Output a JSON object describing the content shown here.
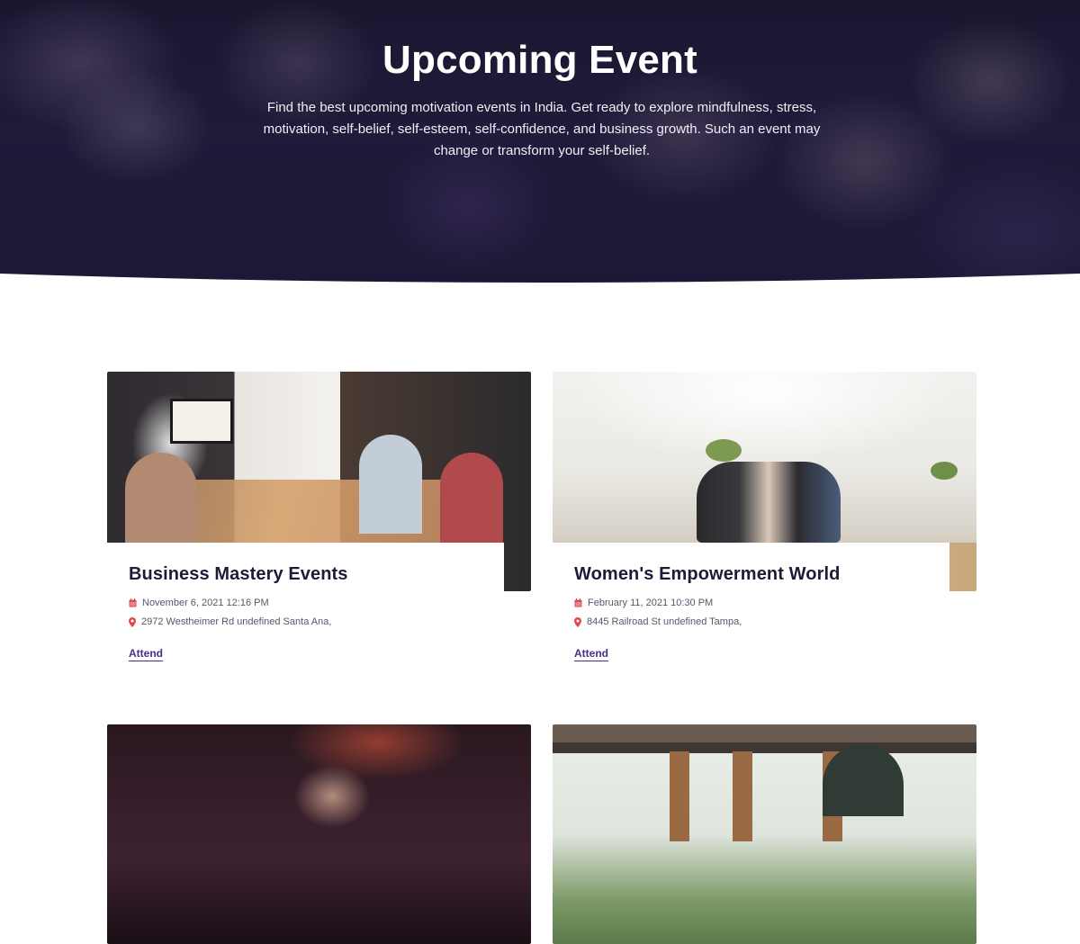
{
  "hero": {
    "title": "Upcoming Event",
    "description": "Find the best upcoming motivation events in India. Get ready to explore mindfulness, stress, motivation, self-belief, self-esteem, self-confidence, and business growth. Such an event may change or transform your self-belief."
  },
  "colors": {
    "accent": "#4b2d86",
    "icon_red": "#e0474c",
    "heading": "#1d1b38",
    "meta_text": "#57566a"
  },
  "icons": {
    "date": "calendar-icon",
    "location": "map-pin-icon"
  },
  "events": [
    {
      "title": "Business Mastery Events",
      "date": "November 6, 2021 12:16 PM",
      "location": "2972 Westheimer Rd undefined Santa Ana,",
      "cta": "Attend"
    },
    {
      "title": "Women's Empowerment World",
      "date": "February 11, 2021 10:30 PM",
      "location": "8445 Railroad St undefined Tampa,",
      "cta": "Attend"
    }
  ]
}
